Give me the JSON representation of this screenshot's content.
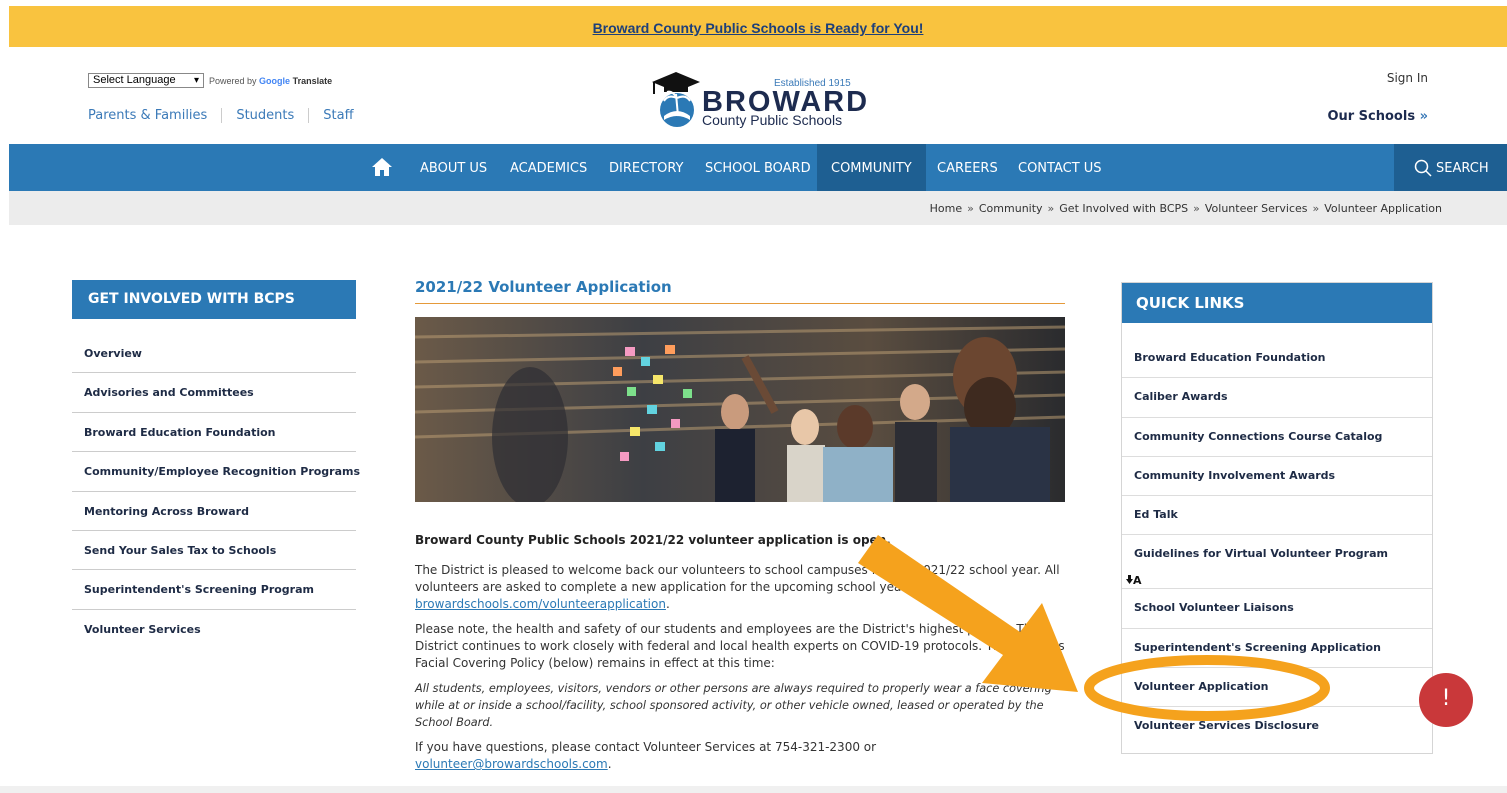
{
  "banner": {
    "text": "Broward County Public Schools is Ready for You!"
  },
  "header": {
    "language_select": "Select Language",
    "powered_by": "Powered by",
    "google": "Google",
    "translate": "Translate",
    "audience_links": [
      "Parents & Families",
      "Students",
      "Staff"
    ],
    "logo": {
      "established": "Established 1915",
      "name": "BROWARD",
      "subtitle": "County Public Schools"
    },
    "sign_in": "Sign In",
    "our_schools": "Our Schools",
    "our_schools_arrow": "»"
  },
  "nav": {
    "home_icon": "home-icon",
    "items": [
      "ABOUT US",
      "ACADEMICS",
      "DIRECTORY",
      "SCHOOL BOARD",
      "COMMUNITY",
      "CAREERS",
      "CONTACT US"
    ],
    "active": "COMMUNITY",
    "search": "SEARCH"
  },
  "breadcrumb": [
    "Home",
    "Community",
    "Get Involved with BCPS",
    "Volunteer Services",
    "Volunteer Application"
  ],
  "breadcrumb_sep": "»",
  "left_sidebar": {
    "title": "GET INVOLVED WITH BCPS",
    "items": [
      "Overview",
      "Advisories and Committees",
      "Broward Education Foundation",
      "Community/Employee Recognition Programs",
      "Mentoring Across Broward",
      "Send Your Sales Tax to Schools",
      "Superintendent's Screening Program",
      "Volunteer Services"
    ]
  },
  "main": {
    "title": "2021/22 Volunteer Application",
    "lead": "Broward County Public Schools 2021/22 volunteer application is open.",
    "p1_text": "The District is pleased to welcome back our volunteers to school campuses for the 2021/22 school year. All volunteers are asked to complete a new application for the upcoming school year at ",
    "p1_link": "browardschools.com/volunteerapplication",
    "p1_end": ".",
    "p2": "Please note, the health and safety of our students and employees are the District's highest priority. The District continues to work closely with federal and local health experts on COVID-19 protocols. The District's Facial Covering Policy (below) remains in effect at this time:",
    "p3": "All students, employees, visitors, vendors or other persons are always required to properly wear a face covering while at or inside a school/facility, school sponsored activity, or other vehicle owned, leased or operated by the School Board.",
    "p4_text": "If you have questions, please contact Volunteer Services at 754-321-2300 or ",
    "p4_link": "volunteer@browardschools.com",
    "p4_end": "."
  },
  "quick_links": {
    "title": "QUICK LINKS",
    "items": [
      "Broward Education Foundation",
      "Caliber Awards",
      "Community Connections Course Catalog",
      "Community Involvement Awards",
      "Ed Talk",
      "Guidelines for Virtual Volunteer Program",
      "School Volunteer Liaisons",
      "Superintendent's Screening Application",
      "Volunteer Application",
      "Volunteer Services Disclosure"
    ],
    "translate_icon_text": "A"
  },
  "feedback": {
    "label": "!"
  },
  "colors": {
    "banner": "#f9c33f",
    "nav": "#2b79b5",
    "nav_active": "#1e5f92",
    "annotation": "#f5a21d",
    "feedback": "#c9383a"
  }
}
